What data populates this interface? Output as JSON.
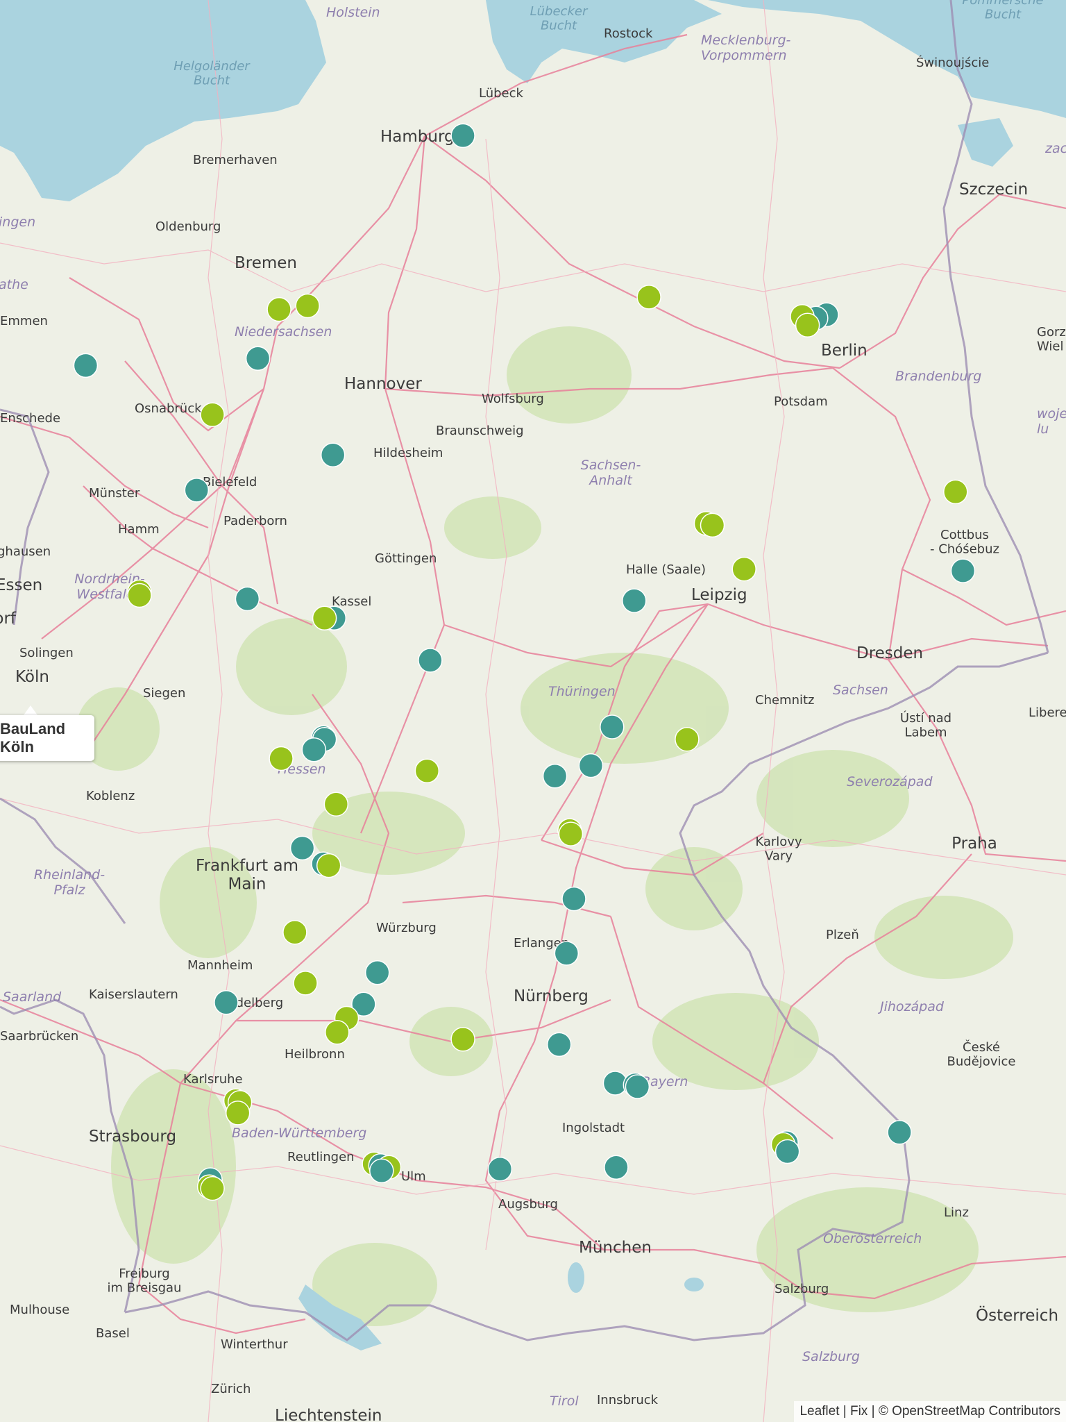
{
  "tooltip": {
    "text": "BauLand Köln"
  },
  "attribution": {
    "leaflet": "Leaflet",
    "sep1": " | ",
    "fix": "Fix",
    "sep2": " | ",
    "osm": "© OpenStreetMap Contributors"
  },
  "colors": {
    "teal": "#3f9a91",
    "lime": "#98c31c",
    "water": "#aad3df",
    "land": "#eef0e6",
    "road": "#e8809a",
    "border": "#9e8fb3"
  },
  "places": [
    {
      "key": "holstein",
      "text": "Holstein"
    },
    {
      "key": "luebecker_bucht",
      "text": "Lübecker\nBucht"
    },
    {
      "key": "rostock",
      "text": "Rostock"
    },
    {
      "key": "mecklenburg",
      "text": "Mecklenburg-\nVorpommern"
    },
    {
      "key": "pommersche",
      "text": "Pommersche\nBucht"
    },
    {
      "key": "swinoujscie",
      "text": "Świnoujście"
    },
    {
      "key": "helgolaender",
      "text": "Helgoländer\nBucht"
    },
    {
      "key": "luebeck",
      "text": "Lübeck"
    },
    {
      "key": "hamburg",
      "text": "Hamburg"
    },
    {
      "key": "bremerhaven",
      "text": "Bremerhaven"
    },
    {
      "key": "szczecin",
      "text": "Szczecin"
    },
    {
      "key": "oldenburg",
      "text": "Oldenburg"
    },
    {
      "key": "bremen",
      "text": "Bremen"
    },
    {
      "key": "emmen",
      "text": "Emmen"
    },
    {
      "key": "niedersachsen",
      "text": "Niedersachsen"
    },
    {
      "key": "hannover",
      "text": "Hannover"
    },
    {
      "key": "wolfsburg",
      "text": "Wolfsburg"
    },
    {
      "key": "braunschweig",
      "text": "Braunschweig"
    },
    {
      "key": "osnabrueck",
      "text": "Osnabrück"
    },
    {
      "key": "enschede",
      "text": "Enschede"
    },
    {
      "key": "hildesheim",
      "text": "Hildesheim"
    },
    {
      "key": "berlin",
      "text": "Berlin"
    },
    {
      "key": "potsdam",
      "text": "Potsdam"
    },
    {
      "key": "brandenburg",
      "text": "Brandenburg"
    },
    {
      "key": "sachsen_anhalt",
      "text": "Sachsen-\nAnhalt"
    },
    {
      "key": "bielefeld",
      "text": "Bielefeld"
    },
    {
      "key": "muenster",
      "text": "Münster"
    },
    {
      "key": "hamm",
      "text": "Hamm"
    },
    {
      "key": "paderborn",
      "text": "Paderborn"
    },
    {
      "key": "goettingen",
      "text": "Göttingen"
    },
    {
      "key": "essen",
      "text": "Essen"
    },
    {
      "key": "nrw",
      "text": "Nordrhein-\nWestfalen"
    },
    {
      "key": "kassel",
      "text": "Kassel"
    },
    {
      "key": "halle",
      "text": "Halle (Saale)"
    },
    {
      "key": "leipzig",
      "text": "Leipzig"
    },
    {
      "key": "cottbus",
      "text": "Cottbus\n- Chóśebuz"
    },
    {
      "key": "duesseldorf",
      "text": "Düsseldorf"
    },
    {
      "key": "solingen",
      "text": "Solingen"
    },
    {
      "key": "dresden",
      "text": "Dresden"
    },
    {
      "key": "koeln",
      "text": "Köln"
    },
    {
      "key": "siegen",
      "text": "Siegen"
    },
    {
      "key": "thueringen",
      "text": "Thüringen"
    },
    {
      "key": "chemnitz",
      "text": "Chemnitz"
    },
    {
      "key": "sachsen",
      "text": "Sachsen"
    },
    {
      "key": "usti",
      "text": "Ústí nad\nLabem"
    },
    {
      "key": "liberec",
      "text": "Liberec"
    },
    {
      "key": "hessen",
      "text": "Hessen"
    },
    {
      "key": "severozapad",
      "text": "Severozápad"
    },
    {
      "key": "koblenz",
      "text": "Koblenz"
    },
    {
      "key": "karlovy",
      "text": "Karlovy\nVary"
    },
    {
      "key": "praha",
      "text": "Praha"
    },
    {
      "key": "frankfurt",
      "text": "Frankfurt am\nMain"
    },
    {
      "key": "rheinland",
      "text": "Rheinland-\nPfalz"
    },
    {
      "key": "wuerzburg",
      "text": "Würzburg"
    },
    {
      "key": "erlangen",
      "text": "Erlangen"
    },
    {
      "key": "plzen",
      "text": "Plzeň"
    },
    {
      "key": "mannheim",
      "text": "Mannheim"
    },
    {
      "key": "kaiserslautern",
      "text": "Kaiserslautern"
    },
    {
      "key": "heidelberg",
      "text": "Heidelberg"
    },
    {
      "key": "nuernberg",
      "text": "Nürnberg"
    },
    {
      "key": "saarland",
      "text": "Saarland"
    },
    {
      "key": "jihozapad",
      "text": "Jihozápad"
    },
    {
      "key": "saarbruecken",
      "text": "Saarbrücken"
    },
    {
      "key": "heilbronn",
      "text": "Heilbronn"
    },
    {
      "key": "ceske",
      "text": "České\nBudějovice"
    },
    {
      "key": "karlsruhe",
      "text": "Karlsruhe"
    },
    {
      "key": "bayern",
      "text": "Bayern"
    },
    {
      "key": "ingolstadt",
      "text": "Ingolstadt"
    },
    {
      "key": "strasbourg",
      "text": "Strasbourg"
    },
    {
      "key": "bawue",
      "text": "Baden-Württemberg"
    },
    {
      "key": "reutlingen",
      "text": "Reutlingen"
    },
    {
      "key": "augsburg",
      "text": "Augsburg"
    },
    {
      "key": "ulm",
      "text": "Ulm"
    },
    {
      "key": "linz",
      "text": "Linz"
    },
    {
      "key": "oberoesterreich",
      "text": "Oberösterreich"
    },
    {
      "key": "muenchen",
      "text": "München"
    },
    {
      "key": "freiburg",
      "text": "Freiburg\nim Breisgau"
    },
    {
      "key": "mulhouse",
      "text": "Mulhouse"
    },
    {
      "key": "salzburg_city",
      "text": "Salzburg"
    },
    {
      "key": "oesterreich",
      "text": "Österreich"
    },
    {
      "key": "basel",
      "text": "Basel"
    },
    {
      "key": "winterthur",
      "text": "Winterthur"
    },
    {
      "key": "salzburg_region",
      "text": "Salzburg"
    },
    {
      "key": "zuerich",
      "text": "Zürich"
    },
    {
      "key": "tirol",
      "text": "Tirol"
    },
    {
      "key": "innsbruck",
      "text": "Innsbruck"
    },
    {
      "key": "liechtenstein",
      "text": "Liechtenstein"
    },
    {
      "key": "ingen",
      "text": "ingen"
    },
    {
      "key": "athe",
      "text": "athe"
    },
    {
      "key": "ghausen",
      "text": "ghausen"
    },
    {
      "key": "zac",
      "text": "zac"
    },
    {
      "key": "woje",
      "text": "woje\nlu"
    },
    {
      "key": "gorz",
      "text": "Gorz\nWiel"
    }
  ],
  "markers": [
    {
      "color": "teal",
      "lat": 53.55,
      "lon": 9.99
    },
    {
      "color": "lime",
      "lat": 52.63,
      "lon": 11.75
    },
    {
      "color": "lime",
      "lat": 52.56,
      "lon": 8.25
    },
    {
      "color": "lime",
      "lat": 52.58,
      "lon": 8.52
    },
    {
      "color": "teal",
      "lat": 52.28,
      "lon": 8.05
    },
    {
      "color": "teal",
      "lat": 52.24,
      "lon": 6.42
    },
    {
      "color": "teal",
      "lat": 52.53,
      "lon": 13.43
    },
    {
      "color": "teal",
      "lat": 52.51,
      "lon": 13.33
    },
    {
      "color": "lime",
      "lat": 52.52,
      "lon": 13.2
    },
    {
      "color": "lime",
      "lat": 52.47,
      "lon": 13.25
    },
    {
      "color": "lime",
      "lat": 51.96,
      "lon": 7.62
    },
    {
      "color": "teal",
      "lat": 51.73,
      "lon": 8.76
    },
    {
      "color": "teal",
      "lat": 51.53,
      "lon": 7.47
    },
    {
      "color": "lime",
      "lat": 51.34,
      "lon": 12.29
    },
    {
      "color": "lime",
      "lat": 51.33,
      "lon": 12.35
    },
    {
      "color": "lime",
      "lat": 51.08,
      "lon": 12.65
    },
    {
      "color": "lime",
      "lat": 51.52,
      "lon": 14.65
    },
    {
      "color": "teal",
      "lat": 51.07,
      "lon": 14.72
    },
    {
      "color": "lime",
      "lat": 50.95,
      "lon": 6.93
    },
    {
      "color": "lime",
      "lat": 50.93,
      "lon": 6.93
    },
    {
      "color": "teal",
      "lat": 50.91,
      "lon": 7.95
    },
    {
      "color": "teal",
      "lat": 50.8,
      "lon": 8.77
    },
    {
      "color": "lime",
      "lat": 50.8,
      "lon": 8.68
    },
    {
      "color": "teal",
      "lat": 50.9,
      "lon": 11.61
    },
    {
      "color": "teal",
      "lat": 50.56,
      "lon": 9.68
    },
    {
      "color": "teal",
      "lat": 50.18,
      "lon": 11.4
    },
    {
      "color": "lime",
      "lat": 50.11,
      "lon": 12.11
    },
    {
      "color": "teal",
      "lat": 50.12,
      "lon": 8.67
    },
    {
      "color": "teal",
      "lat": 50.11,
      "lon": 8.68
    },
    {
      "color": "teal",
      "lat": 50.05,
      "lon": 8.58
    },
    {
      "color": "lime",
      "lat": 50.0,
      "lon": 8.27
    },
    {
      "color": "teal",
      "lat": 49.96,
      "lon": 11.2
    },
    {
      "color": "lime",
      "lat": 49.93,
      "lon": 9.65
    },
    {
      "color": "lime",
      "lat": 49.74,
      "lon": 8.79
    },
    {
      "color": "teal",
      "lat": 49.9,
      "lon": 10.86
    },
    {
      "color": "lime",
      "lat": 49.59,
      "lon": 11.0
    },
    {
      "color": "lime",
      "lat": 49.57,
      "lon": 11.01
    },
    {
      "color": "teal",
      "lat": 49.49,
      "lon": 8.47
    },
    {
      "color": "teal",
      "lat": 49.4,
      "lon": 8.67
    },
    {
      "color": "lime",
      "lat": 49.39,
      "lon": 8.72
    },
    {
      "color": "teal",
      "lat": 49.2,
      "lon": 11.04
    },
    {
      "color": "lime",
      "lat": 49.01,
      "lon": 8.4
    },
    {
      "color": "teal",
      "lat": 48.89,
      "lon": 10.97
    },
    {
      "color": "teal",
      "lat": 48.78,
      "lon": 9.18
    },
    {
      "color": "lime",
      "lat": 48.72,
      "lon": 8.5
    },
    {
      "color": "teal",
      "lat": 48.6,
      "lon": 9.05
    },
    {
      "color": "teal",
      "lat": 48.61,
      "lon": 7.75
    },
    {
      "color": "lime",
      "lat": 48.52,
      "lon": 8.89
    },
    {
      "color": "lime",
      "lat": 48.44,
      "lon": 8.8
    },
    {
      "color": "lime",
      "lat": 48.4,
      "lon": 9.99
    },
    {
      "color": "teal",
      "lat": 48.37,
      "lon": 10.9
    },
    {
      "color": "teal",
      "lat": 48.15,
      "lon": 11.43
    },
    {
      "color": "teal",
      "lat": 48.14,
      "lon": 11.62
    },
    {
      "color": "teal",
      "lat": 48.13,
      "lon": 11.64
    },
    {
      "color": "lime",
      "lat": 48.05,
      "lon": 7.84
    },
    {
      "color": "lime",
      "lat": 48.04,
      "lon": 7.88
    },
    {
      "color": "lime",
      "lat": 47.98,
      "lon": 7.86
    },
    {
      "color": "teal",
      "lat": 47.81,
      "lon": 13.05
    },
    {
      "color": "lime",
      "lat": 47.8,
      "lon": 13.02
    },
    {
      "color": "teal",
      "lat": 47.76,
      "lon": 13.06
    },
    {
      "color": "teal",
      "lat": 47.87,
      "lon": 14.12
    },
    {
      "color": "lime",
      "lat": 47.69,
      "lon": 9.15
    },
    {
      "color": "teal",
      "lat": 47.68,
      "lon": 9.21
    },
    {
      "color": "lime",
      "lat": 47.67,
      "lon": 9.29
    },
    {
      "color": "teal",
      "lat": 47.65,
      "lon": 9.22
    },
    {
      "color": "teal",
      "lat": 47.6,
      "lon": 7.6
    },
    {
      "color": "teal",
      "lat": 47.66,
      "lon": 10.34
    },
    {
      "color": "teal",
      "lat": 47.67,
      "lon": 11.44
    },
    {
      "color": "lime",
      "lat": 47.56,
      "lon": 7.59
    },
    {
      "color": "lime",
      "lat": 47.55,
      "lon": 7.62
    }
  ]
}
